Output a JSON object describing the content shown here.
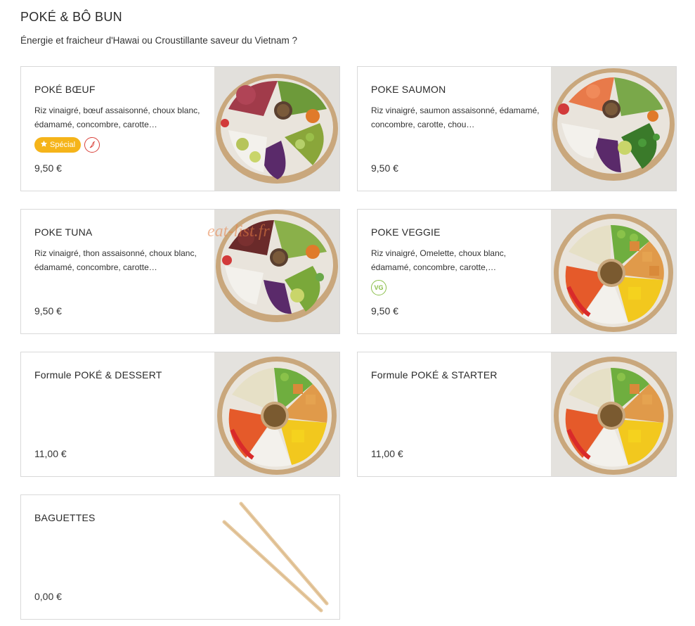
{
  "section": {
    "title": "POKÉ & BÔ BUN",
    "subtitle": "Énergie et fraicheur d'Hawai ou Croustillante saveur du Vietnam ?"
  },
  "watermark": "eat-list.fr",
  "items": [
    {
      "name": "POKÉ BŒUF",
      "description": "Riz vinaigré, bœuf assaisonné, choux blanc, édamamé, concombre, carotte…",
      "price": "9,50 €",
      "badge_special": "Spécial",
      "icons": [
        "star-icon",
        "chili-pepper-icon"
      ],
      "image": "beef-poke-bowl"
    },
    {
      "name": "POKE SAUMON",
      "description": "Riz vinaigré, saumon assaisonné, édamamé, concombre, carotte, chou…",
      "price": "9,50 €",
      "image": "salmon-poke-bowl"
    },
    {
      "name": "POKE TUNA",
      "description": "Riz vinaigré, thon assaisonné, choux blanc, édamamé, concombre, carotte…",
      "price": "9,50 €",
      "image": "tuna-poke-bowl"
    },
    {
      "name": "POKE VEGGIE",
      "description": "Riz vinaigré, Omelette, choux blanc, édamamé, concombre, carotte,…",
      "price": "9,50 €",
      "badge_vg": "VG",
      "image": "veggie-poke-bowl"
    },
    {
      "name": "Formule POKÉ & DESSERT",
      "description": "",
      "price": "11,00 €",
      "image": "veggie-poke-bowl"
    },
    {
      "name": "Formule POKÉ & STARTER",
      "description": "",
      "price": "11,00 €",
      "image": "veggie-poke-bowl"
    },
    {
      "name": "BAGUETTES",
      "description": "",
      "price": "0,00 €",
      "image": "chopsticks"
    }
  ],
  "colors": {
    "card_border": "#d9d9d9",
    "special_badge": "#f5b41a",
    "spicy_icon": "#d9413a",
    "vg_icon": "#8bbf4a",
    "bowl_rim": "#c9a77c"
  }
}
